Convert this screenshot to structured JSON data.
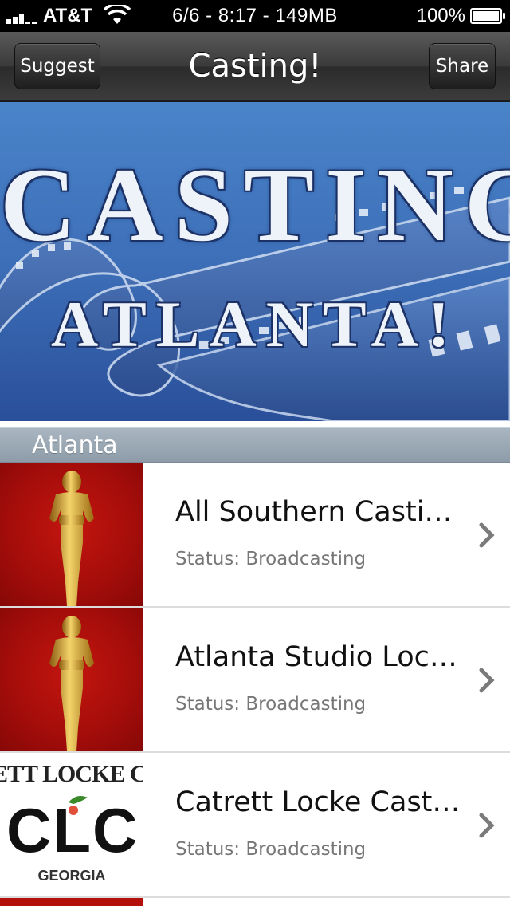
{
  "status_bar": {
    "carrier": "AT&T",
    "center_text": "6/6 - 8:17 - 149MB",
    "battery": "100%"
  },
  "nav": {
    "title": "Casting!",
    "left_button": "Suggest",
    "right_button": "Share"
  },
  "banner": {
    "line1": "CASTING",
    "line2": "ATLANTA!"
  },
  "section": {
    "header": "Atlanta"
  },
  "list": {
    "items": [
      {
        "title": "All Southern Casting ...",
        "status": "Status: Broadcasting",
        "thumb": "oscar-statue-icon"
      },
      {
        "title": "Atlanta Studio Locatio...",
        "status": "Status: Broadcasting",
        "thumb": "oscar-statue-icon"
      },
      {
        "title": "Catrett Locke Casting",
        "status": "Status: Broadcasting",
        "thumb": "clc-logo",
        "logo": {
          "top": "ETT LOCKE CAS",
          "main": "CLC",
          "state": "GEORGIA"
        }
      }
    ]
  },
  "colors": {
    "nav_bg": "#3a3a3a",
    "banner_blue": "#3d6fb8",
    "section_header": "#9aa8b4",
    "thumb_red": "#b3100c",
    "gold": "#d4a028"
  }
}
